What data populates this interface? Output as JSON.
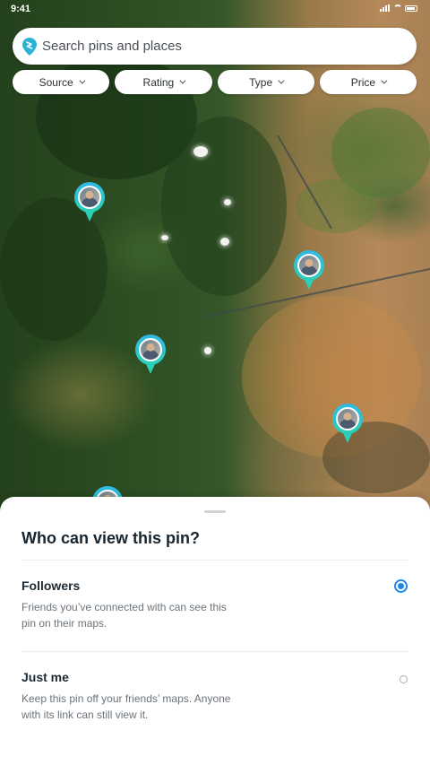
{
  "status_bar": {
    "time": "9:41"
  },
  "search": {
    "placeholder": "Search pins and places"
  },
  "filters": [
    {
      "label": "Source"
    },
    {
      "label": "Rating"
    },
    {
      "label": "Type"
    },
    {
      "label": "Price"
    }
  ],
  "map": {
    "pin_count_visible": 5
  },
  "sheet": {
    "title": "Who can view this pin?",
    "options": [
      {
        "title": "Followers",
        "description": "Friends you’ve connected with can see this pin on their maps.",
        "selected": true
      },
      {
        "title": "Just me",
        "description": "Keep this pin off your friends’ maps. Anyone with its link can still view it.",
        "selected": false
      }
    ]
  },
  "colors": {
    "accent": "#1e88e5",
    "pin_gradient_top": "#2fb9e7",
    "pin_gradient_bottom": "#2ad0b5"
  }
}
